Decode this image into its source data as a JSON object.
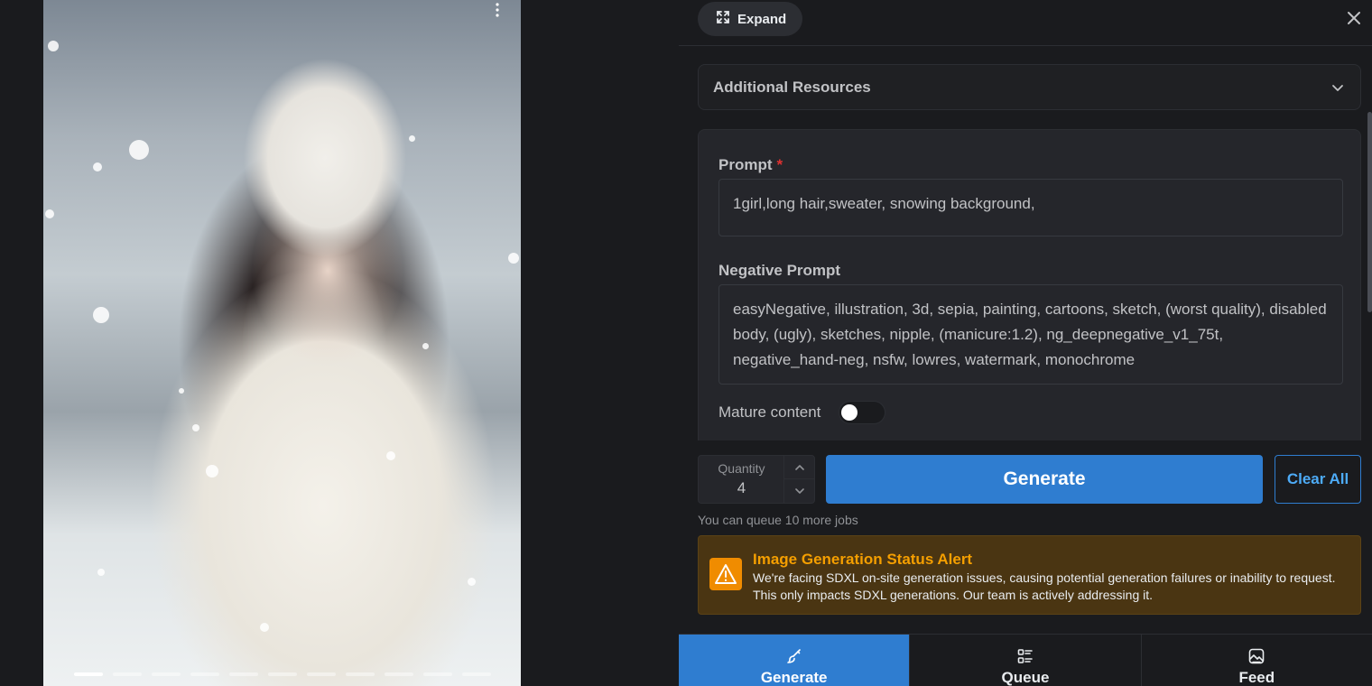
{
  "toolbar": {
    "expand_label": "Expand",
    "expand_icon": "expand-arrows-icon",
    "close_icon": "close-icon"
  },
  "additional_resources": {
    "title": "Additional Resources",
    "icon": "chevron-down-icon"
  },
  "prompt": {
    "label": "Prompt",
    "required_mark": "*",
    "value": "1girl,long hair,sweater, snowing background,"
  },
  "negative_prompt": {
    "label": "Negative Prompt",
    "value": "easyNegative, illustration, 3d, sepia, painting, cartoons, sketch, (worst quality), disabled body, (ugly), sketches, nipple, (manicure:1.2), ng_deepnegative_v1_75t, negative_hand-neg, nsfw, lowres, watermark, monochrome"
  },
  "mature_content": {
    "label": "Mature content",
    "enabled": false
  },
  "quantity": {
    "label": "Quantity",
    "value": "4"
  },
  "actions": {
    "generate_label": "Generate",
    "clear_label": "Clear All"
  },
  "queue_note": "You can queue 10 more jobs",
  "alert": {
    "icon": "warning-icon",
    "title": "Image Generation Status Alert",
    "body": "We're facing SDXL on-site generation issues, causing potential generation failures or inability to request. This only impacts SDXL generations. Our team is actively addressing it."
  },
  "bottom_nav": {
    "tabs": [
      {
        "label": "Generate",
        "icon": "brush-icon",
        "active": true
      },
      {
        "label": "Queue",
        "icon": "list-icon",
        "active": false
      },
      {
        "label": "Feed",
        "icon": "image-feed-icon",
        "active": false
      }
    ]
  },
  "carousel": {
    "slide_count": 11,
    "active_index": 0
  },
  "colors": {
    "accent": "#2f7dd0",
    "alert_bg": "#4a3512",
    "alert_title": "#f59f00",
    "background": "#1a1b1e"
  }
}
